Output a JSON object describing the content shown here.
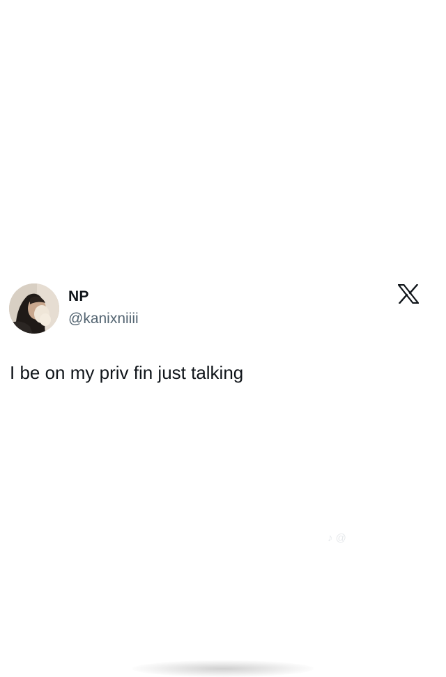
{
  "tweet": {
    "display_name": "NP",
    "handle": "@kanixniiii",
    "text": "I be on my priv fin just talking",
    "platform_icon": "x-logo-icon",
    "avatar_icon": "profile-photo"
  },
  "watermark": {
    "icon": "tiktok-icon",
    "text": "@"
  },
  "colors": {
    "background": "#ffffff",
    "primary_text": "#0f1419",
    "secondary_text": "#536471"
  }
}
